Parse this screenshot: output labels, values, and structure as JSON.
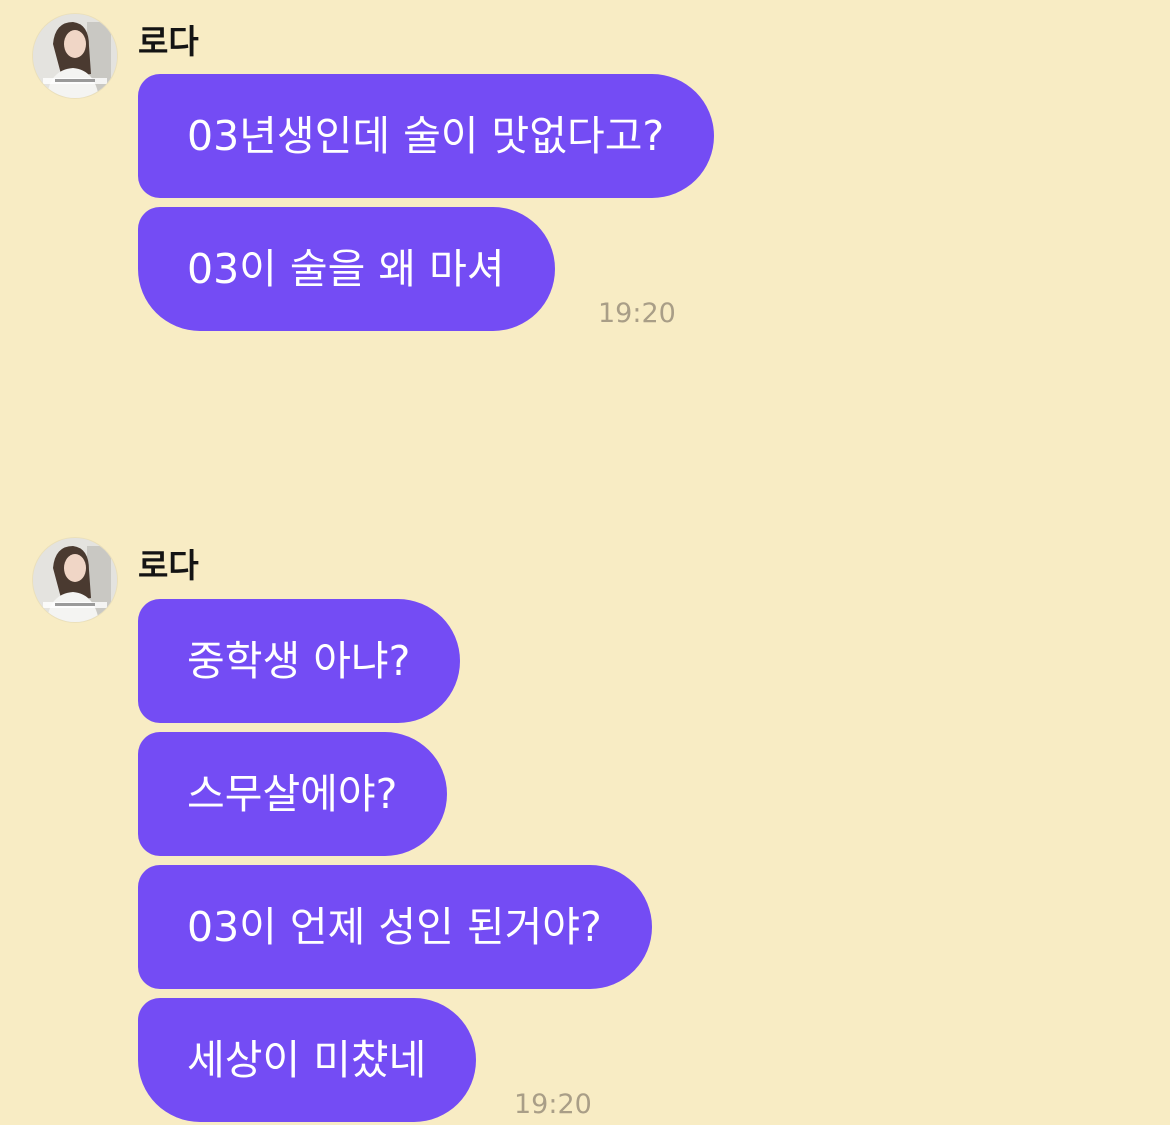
{
  "colors": {
    "background": "#f8ecc4",
    "bubble": "#744cf4",
    "bubble_text": "#ffffff",
    "timestamp": "#a99e87"
  },
  "groups": [
    {
      "sender": "로다",
      "avatar_icon": "profile-photo",
      "messages": [
        "03년생인데 술이 맛없다고?",
        "03이 술을 왜 마셔"
      ],
      "time": "19:20"
    },
    {
      "sender": "로다",
      "avatar_icon": "profile-photo",
      "messages": [
        "중학생 아냐?",
        "스무살에야?",
        "03이 언제 성인 된거야?",
        "세상이 미챴네"
      ],
      "time": "19:20"
    }
  ]
}
